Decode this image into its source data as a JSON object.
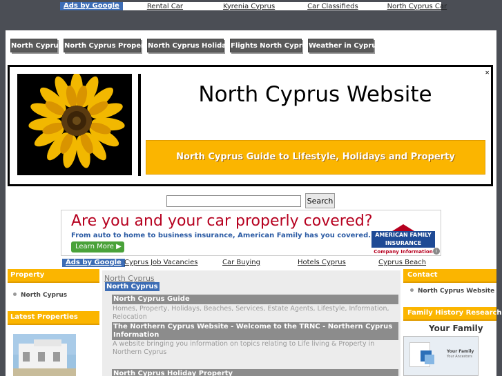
{
  "top_ads": {
    "label": "Ads by Google",
    "links": [
      "Rental Car",
      "Kyrenia Cyprus",
      "Car Classifieds",
      "North Cyprus Car"
    ]
  },
  "nav": [
    "North Cyprus",
    "North Cyprus Property",
    "North Cyprus Holidays",
    "Flights North Cyprus",
    "Weather in Cyprus"
  ],
  "header": {
    "title": "North Cyprus Website",
    "tagline": "North Cyprus Guide to Lifestyle, Holidays and Property"
  },
  "search": {
    "value": "",
    "button": "Search"
  },
  "banner_ad": {
    "headline": "Are you and your car properly covered?",
    "subtext": "From auto to home to business insurance, American Family has you covered.",
    "button": "Learn More ▶",
    "brand_line1": "AMERICAN FAMILY",
    "brand_line2": "INSURANCE",
    "brand_info": "Company Information"
  },
  "ads2": {
    "label": "Ads by Google",
    "links": [
      "Cyprus Job Vacancies",
      "Car Buying",
      "Hotels Cyprus",
      "Cyprus Beach"
    ]
  },
  "left": {
    "property_heading": "Property",
    "property_items": [
      "North Cyprus"
    ],
    "latest_heading": "Latest Properties"
  },
  "center": {
    "breadcrumb": "North Cyprus",
    "selected": "North Cyprus",
    "entries": [
      {
        "title": "North Cyprus Guide",
        "desc": "Homes, Property, Holidays, Beaches, Services, Estate Agents, Lifestyle, Information, Relocation"
      },
      {
        "title": "The Northern Cyprus Website - Welcome to the TRNC - Northern Cyprus Information",
        "desc": "A website bringing you information on topics relating to Life living & Property in Northern Cyprus"
      },
      {
        "title": "North Cyprus Holiday Property",
        "desc": ""
      }
    ]
  },
  "right": {
    "contact_heading": "Contact",
    "contact_items": [
      "North Cyprus Website"
    ],
    "family_heading": "Family History Research",
    "family_title": "Your Family",
    "family_ad_line1": "Your Family",
    "family_ad_line2": "Your Ancestors"
  },
  "colors": {
    "accent_orange": "#fbb500",
    "nav_grey": "#5a5a5a",
    "google_blue": "#3d6db5",
    "banner_red": "#b6001f"
  }
}
